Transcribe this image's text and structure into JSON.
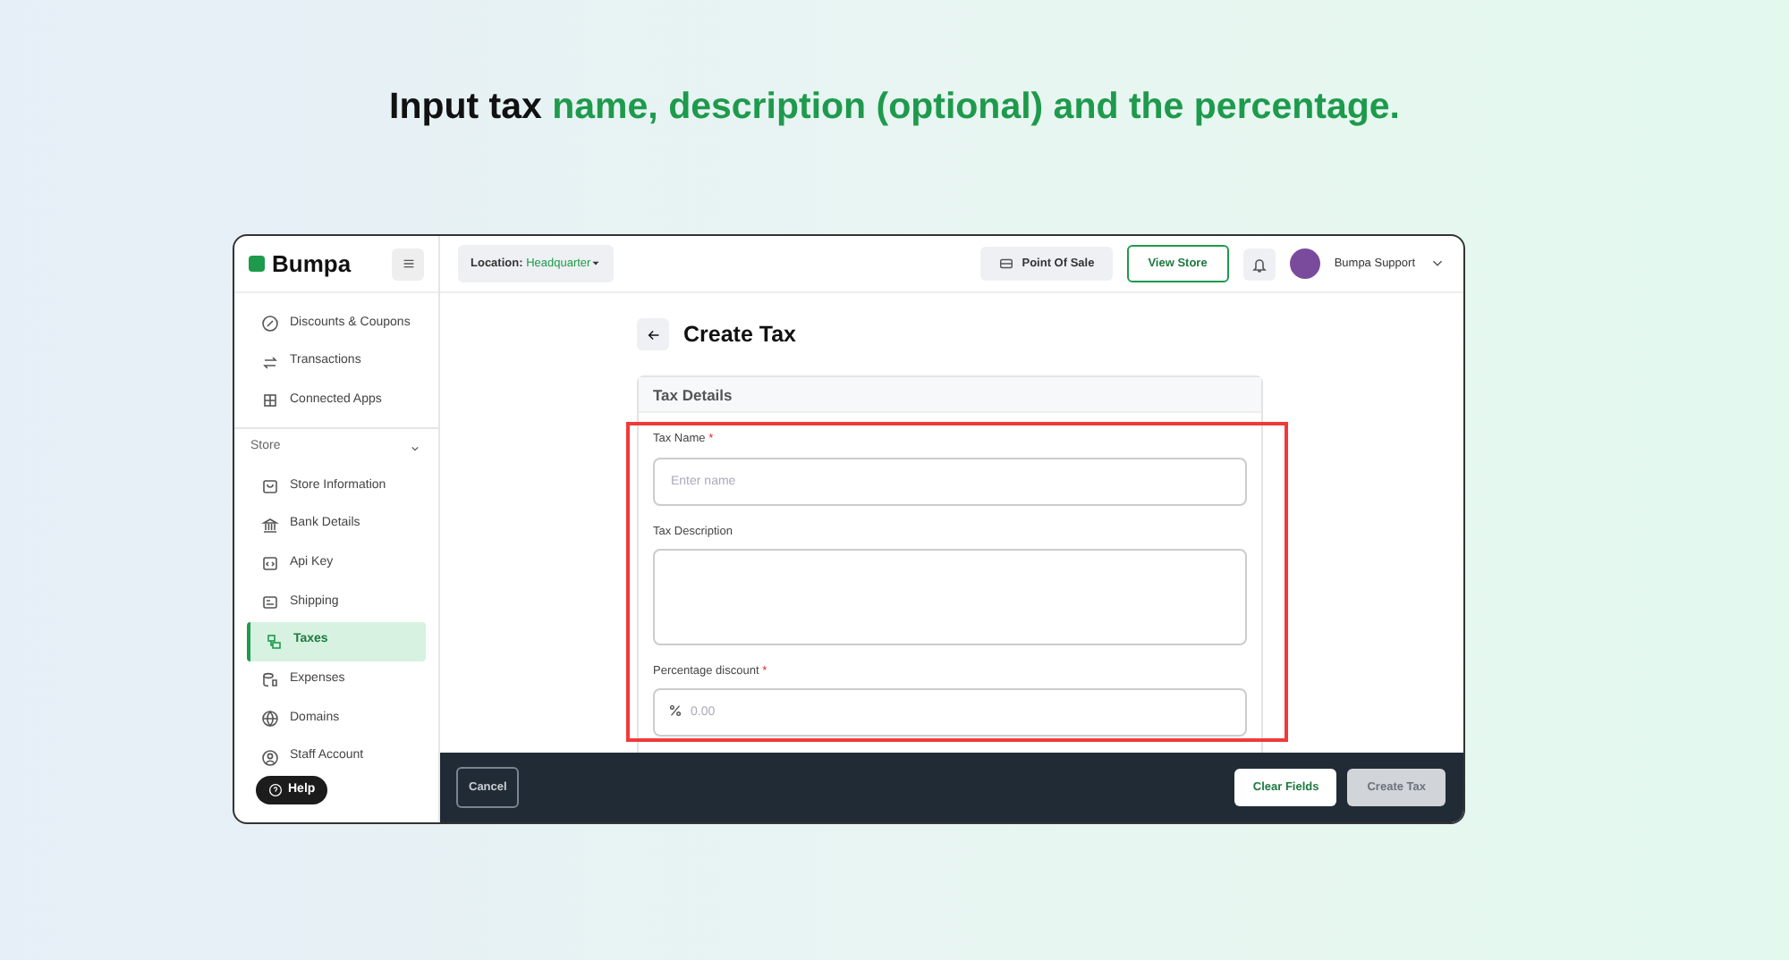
{
  "headline": {
    "lead": "Input tax",
    "accent": "name, description (optional) and the percentage."
  },
  "topbar": {
    "logo": "Bumpa",
    "location_label": "Location:",
    "location_value": "Headquarter",
    "point_of_sale": "Point Of Sale",
    "view_store": "View Store",
    "user": "Bumpa Support"
  },
  "sidebar": {
    "items_top": [
      {
        "label": "Discounts & Coupons",
        "selected": false
      },
      {
        "label": "Transactions",
        "selected": false
      },
      {
        "label": "Connected Apps",
        "selected": false
      }
    ],
    "section": {
      "label": "Store",
      "expanded": true
    },
    "items": [
      {
        "label": "Store Information",
        "selected": false
      },
      {
        "label": "Bank Details",
        "selected": false
      },
      {
        "label": "Api Key",
        "selected": false
      },
      {
        "label": "Shipping",
        "selected": false
      },
      {
        "label": "Taxes",
        "selected": true
      },
      {
        "label": "Expenses",
        "selected": false
      },
      {
        "label": "Domains",
        "selected": false
      },
      {
        "label": "Staff Account",
        "selected": false
      }
    ],
    "help": "Help"
  },
  "page": {
    "title": "Create Tax",
    "card_title": "Tax Details",
    "fields": [
      {
        "kind": "text",
        "label": "Tax Name",
        "required_mark": "*",
        "placeholder": "Enter name"
      },
      {
        "kind": "textarea",
        "label": "Tax Description"
      },
      {
        "kind": "percent",
        "label": "Percentage discount",
        "required_mark": "*",
        "placeholder": "0.00"
      }
    ]
  },
  "footer": {
    "cancel": "Cancel",
    "clear": "Clear Fields",
    "create": {
      "label": "Create Tax",
      "disabled": true
    }
  }
}
